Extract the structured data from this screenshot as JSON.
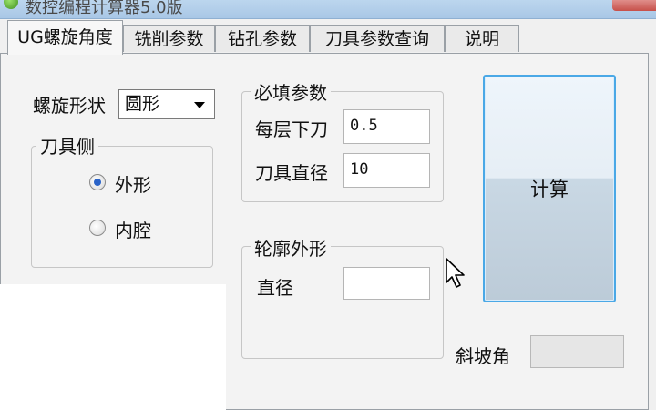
{
  "window": {
    "title": "数控编程计算器5.0版"
  },
  "tabs": [
    {
      "label": "UG螺旋角度",
      "active": true
    },
    {
      "label": "铣削参数",
      "active": false
    },
    {
      "label": "钻孔参数",
      "active": false
    },
    {
      "label": "刀具参数查询",
      "active": false
    },
    {
      "label": "说明",
      "active": false
    }
  ],
  "shape": {
    "label": "螺旋形状",
    "selected": "圆形"
  },
  "tool_side": {
    "title": "刀具侧",
    "options": [
      {
        "label": "外形",
        "checked": true
      },
      {
        "label": "内腔",
        "checked": false
      }
    ]
  },
  "required": {
    "title": "必填参数",
    "step_down_label": "每层下刀",
    "step_down_value": "0.5",
    "tool_diameter_label": "刀具直径",
    "tool_diameter_value": "10"
  },
  "contour": {
    "title": "轮廓外形",
    "diameter_label": "直径",
    "diameter_value": ""
  },
  "calculate_label": "计算",
  "ramp_angle": {
    "label": "斜坡角",
    "value": ""
  },
  "colors": {
    "button_border": "#4aa8e6",
    "radio_checked": "#2a63c8",
    "titlebar": "#bcd6ee"
  },
  "icons": {
    "cursor": "mouse-pointer-icon",
    "app": "app-icon"
  }
}
